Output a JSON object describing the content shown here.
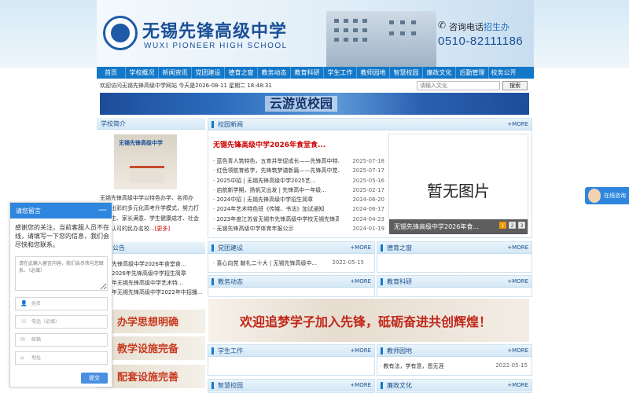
{
  "header": {
    "school_cn": "无锡先锋高级中学",
    "school_en": "WUXI PIONEER HIGH SCHOOL",
    "hotline_prefix": "咨询电话",
    "hotline_suffix": "招生办",
    "hotline_number": "0510-82111186"
  },
  "nav": [
    "首页",
    "学校概况",
    "新闻资讯",
    "党团建设",
    "德育之窗",
    "教务动态",
    "教育科研",
    "学生工作",
    "教师园地",
    "智慧校园",
    "廉政文化",
    "后勤管理",
    "校务公开"
  ],
  "welcome": "欢迎访问无锡先锋高级中学网站    今天是2026-08-11 星期二 18:48:31",
  "search": {
    "placeholder": "请输入文化",
    "button": "搜索"
  },
  "banner": {
    "text": "云游览校园"
  },
  "intro": {
    "title": "学校简介",
    "image_logo": "无锡先锋高级中学",
    "text": "无锡先锋高级中学以特色办学、名师办校、出彩的多元化高考升学模式，努力打造学生、家长满意、学生健康成才、社会高度认可的民办名校...",
    "more": "[更多]"
  },
  "notice": {
    "title": "公告",
    "items": [
      "先锋高级中学2026年食堂食...",
      "2026年先锋高级中学招生简章",
      "年无锡先锋高级中学艺术特...",
      "年无锡先锋高级中学2022年中招播..."
    ]
  },
  "promos": [
    "办学思想明确",
    "教学设施完备",
    "配套设施完善"
  ],
  "news": {
    "title": "校园新闻",
    "more": "+MORE",
    "headline": "无锡先锋高级中学2026年食堂食...",
    "items": [
      {
        "title": "· 蓝色青人筑特色，五育并举促成长——先锋高中特...",
        "date": "2025-07-18"
      },
      {
        "title": "· 红色领航育栋学，先锋筑梦谱新篇——先锋高中党...",
        "date": "2025-07-17"
      },
      {
        "title": "· 2025中招 | 无锡先锋高级中学2025艺...",
        "date": "2025-05-16"
      },
      {
        "title": "· 启航新学期，扬帆又出发 | 先锋高中一年级...",
        "date": "2025-02-17"
      },
      {
        "title": "· 2024中招 | 无锡先锋高级中学招生简章",
        "date": "2024-06-20"
      },
      {
        "title": "· 2024年艺术特色班《传媒、书法》加试通知",
        "date": "2024-06-17"
      },
      {
        "title": "· 2023年度江苏省无锡市先锋高级中学校无锡先锋高级...",
        "date": "2024-04-23"
      },
      {
        "title": "· 无锡先锋高级中学体育年报公示",
        "date": "2024-01-19"
      }
    ],
    "no_image": "暂无图片",
    "caption": "无锡先锋高级中学2026年食...",
    "pages": [
      "1",
      "2",
      "3"
    ]
  },
  "sections": {
    "party": {
      "title": "党团建设",
      "more": "+MORE",
      "item": "· 喜心向党 献礼二十大 | 无锡先锋高级中...",
      "date": "2022-05-15"
    },
    "moral": {
      "title": "德育之窗",
      "more": "+MORE"
    },
    "teaching": {
      "title": "教务动态",
      "more": "+MORE"
    },
    "research": {
      "title": "教育科研",
      "more": "+MORE"
    },
    "student": {
      "title": "学生工作",
      "more": "+MORE"
    },
    "teacher": {
      "title": "教师园地",
      "more": "+MORE",
      "item": "· 教有法，学有意，恩无涯",
      "date": "2022-05-15"
    },
    "smart": {
      "title": "智慧校园",
      "more": "+MORE"
    },
    "integrity": {
      "title": "廉政文化",
      "more": "+MORE"
    }
  },
  "slogan": "欢迎追梦学子加入先锋，砥砺奋进共创辉煌！",
  "float_consult": "在线咨询",
  "chat": {
    "title": "请您留言",
    "message": "感谢您的关注，当前客服人员不在线，请填写一下您的信息，我们会尽快和您联系。",
    "textarea_placeholder": "请在此输入留言内容，我们会尽快与您联系。（必填）",
    "name_placeholder": "姓名",
    "phone_placeholder": "电话（必填）",
    "email_placeholder": "邮箱",
    "address_placeholder": "地址",
    "submit": "提交"
  },
  "colors": {
    "nav_bg": "#1478c8",
    "accent": "#1a4f8c",
    "headline": "#cc0000",
    "chat_head": "#2e86de"
  }
}
